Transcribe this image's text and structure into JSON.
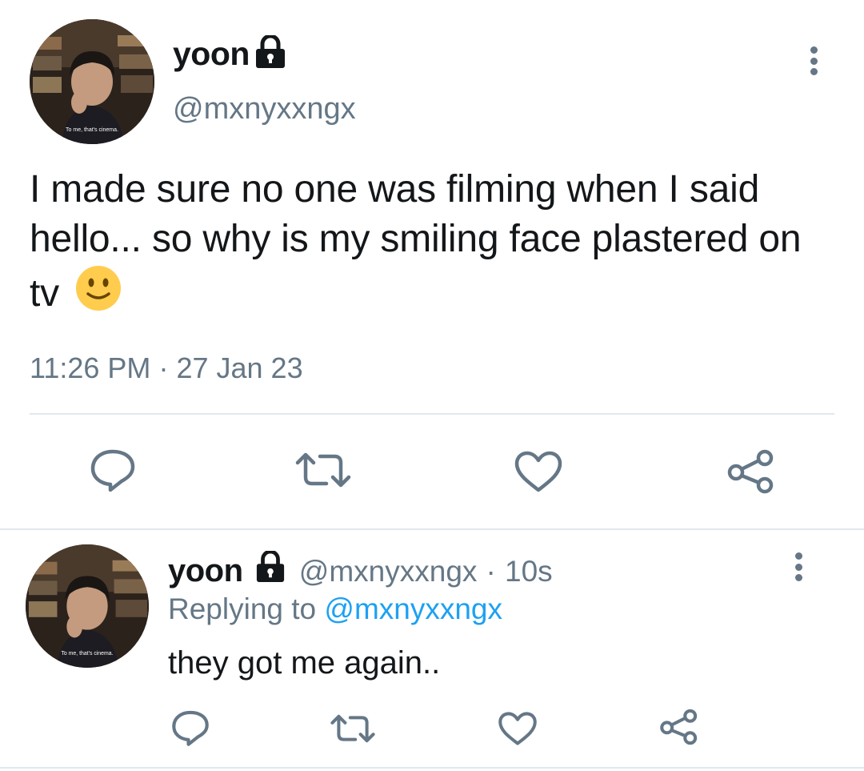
{
  "main_tweet": {
    "avatar_caption": "To me, that's cinema.",
    "display_name": "yoon",
    "handle": "@mxnyxxngx",
    "text": "I made sure no one was filming when I said hello... so why is my smiling face plastered on tv",
    "emoji": "🙂",
    "time": "11:26 PM",
    "separator": "·",
    "date": "27 Jan 23",
    "actions": [
      "reply-icon",
      "retweet-icon",
      "like-icon",
      "share-icon"
    ]
  },
  "reply_tweet": {
    "avatar_caption": "To me, that's cinema.",
    "display_name": "yoon",
    "handle": "@mxnyxxngx",
    "separator": "·",
    "age": "10s",
    "replying_label": "Replying to",
    "replying_handle": "@mxnyxxngx",
    "text": "they got me again..",
    "actions": [
      "reply-icon",
      "retweet-icon",
      "like-icon",
      "share-icon"
    ]
  },
  "colors": {
    "accent": "#1da1f2",
    "text": "#14171a",
    "secondary": "#657786",
    "divider": "#e1e8ed"
  }
}
